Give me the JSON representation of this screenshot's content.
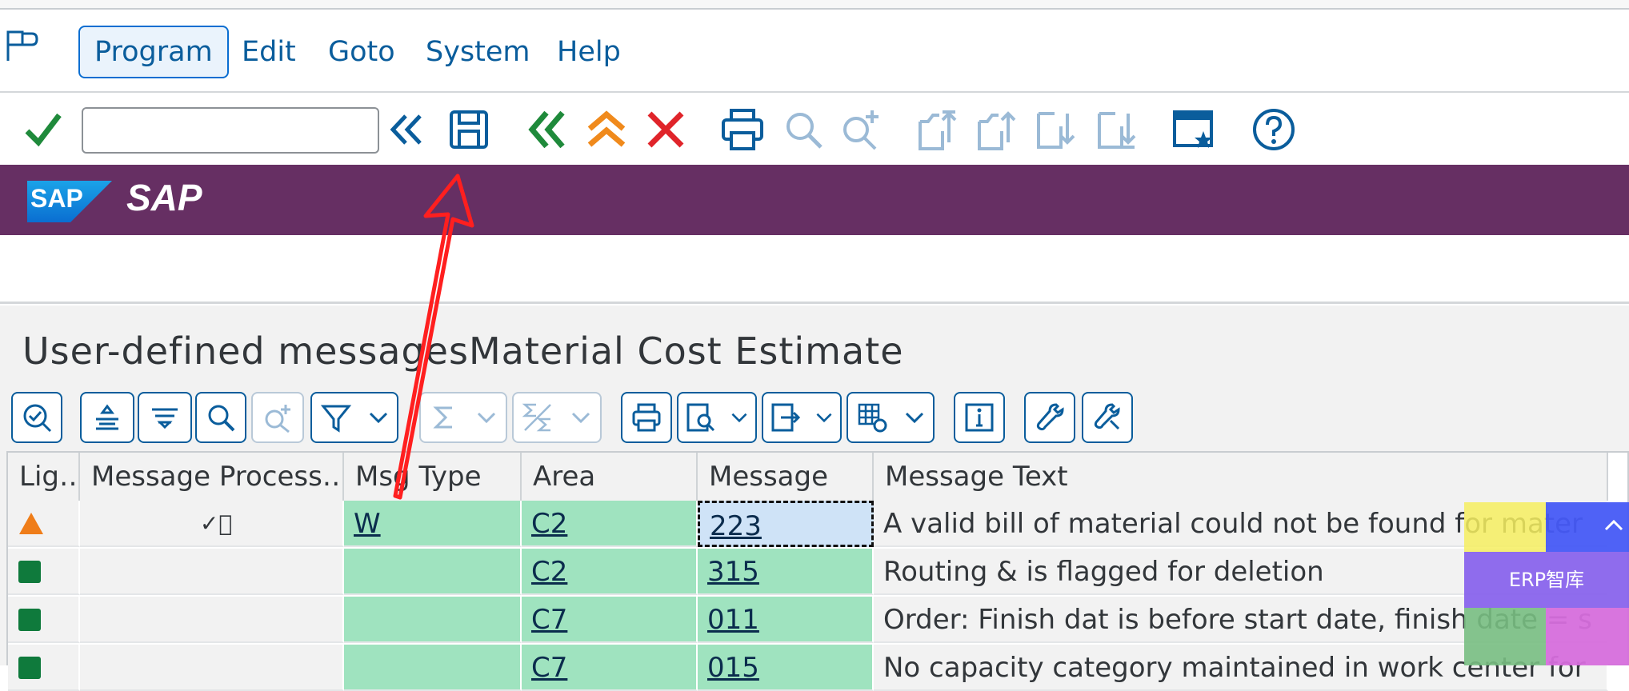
{
  "menu": {
    "items": [
      {
        "label": "Program"
      },
      {
        "label": "Edit"
      },
      {
        "label": "Goto"
      },
      {
        "label": "System"
      },
      {
        "label": "Help"
      }
    ]
  },
  "toolbar": {
    "command_value": "",
    "icons": [
      "checkmark-icon",
      "double-chevron-left-icon",
      "save-icon",
      "back-icon",
      "exit-icon",
      "cancel-icon",
      "print-icon",
      "find-icon",
      "find-next-icon",
      "first-page-icon",
      "previous-page-icon",
      "next-page-icon",
      "last-page-icon",
      "create-shortcut-icon",
      "help-icon"
    ]
  },
  "banner": {
    "logo_text": "SAP",
    "title": "SAP",
    "color": "#662f63"
  },
  "page": {
    "title": "User-defined messagesMaterial Cost Estimate"
  },
  "table": {
    "columns": [
      "Lig…",
      "Message Process…",
      "Msg Type",
      "Area",
      "Message",
      "Message Text"
    ],
    "rows": [
      {
        "light": "warning",
        "process": "✓⃞",
        "type": "W",
        "area": "C2",
        "message": "223",
        "text": "A valid bill of material could not be found for mater"
      },
      {
        "light": "ok",
        "process": "",
        "type": "",
        "area": "C2",
        "message": "315",
        "text": "Routing & is flagged for deletion"
      },
      {
        "light": "ok",
        "process": "",
        "type": "",
        "area": "C7",
        "message": "011",
        "text": "Order: Finish dat is before start date, finish date = s"
      },
      {
        "light": "ok",
        "process": "",
        "type": "",
        "area": "C7",
        "message": "015",
        "text": "No capacity category maintained in work center for"
      }
    ]
  },
  "watermark": {
    "text": "ERP智库"
  },
  "colors": {
    "accent": "#0a5d9c",
    "green_cell": "#9fe3bf",
    "selected_cell": "#cfe3f7",
    "arrow": "#ff1f1f"
  }
}
